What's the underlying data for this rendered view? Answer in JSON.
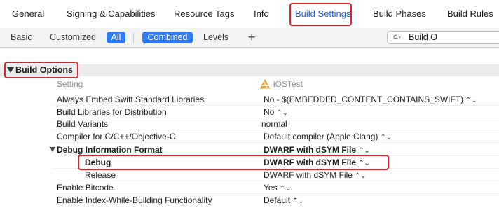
{
  "tabs": [
    {
      "label": "General",
      "active": false
    },
    {
      "label": "Signing & Capabilities",
      "active": false
    },
    {
      "label": "Resource Tags",
      "active": false
    },
    {
      "label": "Info",
      "active": false
    },
    {
      "label": "Build Settings",
      "active": true
    },
    {
      "label": "Build Phases",
      "active": false
    },
    {
      "label": "Build Rules",
      "active": false
    }
  ],
  "filters": {
    "basic": "Basic",
    "customized": "Customized",
    "all": "All",
    "combined": "Combined",
    "levels": "Levels",
    "plus": "+"
  },
  "search": {
    "value": "Build O",
    "icon": "magnifier-dropdown-icon"
  },
  "section": {
    "title": "Build Options",
    "expanded": true
  },
  "columns": {
    "setting": "Setting",
    "target": "iOSTest",
    "target_icon": "app-target-icon"
  },
  "settings": [
    {
      "name": "Always Embed Swift Standard Libraries",
      "value": "No  -  $(EMBEDDED_CONTENT_CONTAINS_SWIFT)",
      "stepper": "⌃⌄"
    },
    {
      "name": "Build Libraries for Distribution",
      "value": "No",
      "stepper": "⌃⌄"
    },
    {
      "name": "Build Variants",
      "value": "normal",
      "stepper": ""
    },
    {
      "name": "Compiler for C/C++/Objective-C",
      "value": "Default compiler (Apple Clang)",
      "stepper": "⌃⌄"
    },
    {
      "name": "Debug Information Format",
      "value": "DWARF with dSYM File",
      "stepper": "⌃⌄"
    },
    {
      "name": "Debug",
      "value": "DWARF with dSYM File",
      "stepper": "⌃⌄"
    },
    {
      "name": "Release",
      "value": "DWARF with dSYM File",
      "stepper": "⌃⌄"
    },
    {
      "name": "Enable Bitcode",
      "value": "Yes",
      "stepper": "⌃⌄"
    },
    {
      "name": "Enable Index-While-Building Functionality",
      "value": "Default",
      "stepper": "⌃⌄"
    }
  ],
  "colors": {
    "accent": "#2f7bf5",
    "highlight": "#d9252b",
    "active_tab": "#1a5fd6"
  }
}
